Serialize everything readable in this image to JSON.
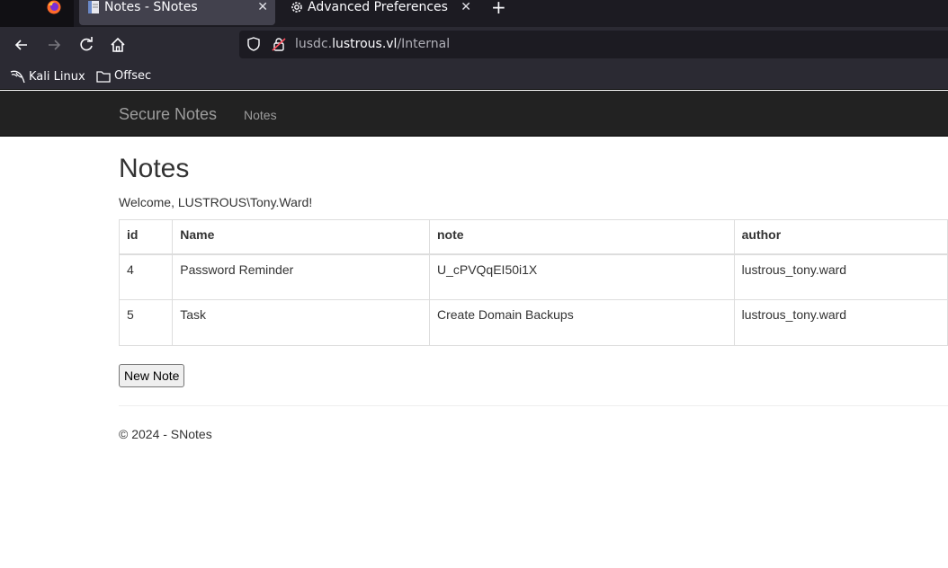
{
  "browser": {
    "tabs": [
      {
        "title": "Notes - SNotes",
        "active": true
      },
      {
        "title": "Advanced Preferences",
        "active": false
      }
    ],
    "url": {
      "prefix": "lusdc.",
      "host": "lustrous.vl",
      "path": "/Internal"
    },
    "bookmarks": [
      {
        "label": "Kali Linux",
        "icon": "kali-dragon-icon"
      },
      {
        "label": "Offsec",
        "icon": "folder-icon"
      }
    ]
  },
  "site": {
    "brand": "Secure Notes",
    "nav_link": "Notes"
  },
  "main": {
    "title": "Notes",
    "welcome": "Welcome, LUSTROUS\\Tony.Ward!",
    "table": {
      "headers": [
        "id",
        "Name",
        "note",
        "author"
      ],
      "rows": [
        [
          "4",
          "Password Reminder",
          "U_cPVQqEI50i1X",
          "lustrous_tony.ward"
        ],
        [
          "5",
          "Task",
          "Create Domain Backups",
          "lustrous_tony.ward"
        ]
      ]
    },
    "new_note_label": "New Note"
  },
  "footer": {
    "text": "© 2024 - SNotes"
  }
}
